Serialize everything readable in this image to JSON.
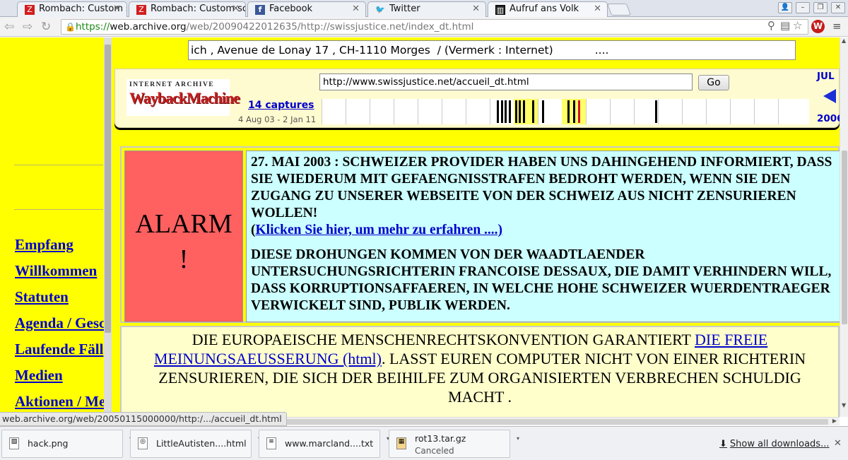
{
  "browser": {
    "tabs": [
      {
        "title": "Rombach: Custom sc",
        "icon": "zotero-icon"
      },
      {
        "title": "Rombach: Custom sc",
        "icon": "zotero-icon"
      },
      {
        "title": "Facebook",
        "icon": "facebook-icon"
      },
      {
        "title": "Twitter",
        "icon": "twitter-icon"
      },
      {
        "title": "Aufruf ans Volk",
        "icon": "wayback-icon"
      }
    ],
    "url": {
      "scheme": "https://",
      "host": "web.archive.org",
      "path": "/web/20090422012635/http://swissjustice.net/index_dt.html"
    }
  },
  "page": {
    "address_line": "ich , Avenue de Lonay 17 , CH-1110 Morges  / (Vermerk : Internet)            ....",
    "sidebar_links": [
      "Empfang",
      "Willkommen",
      "Statuten",
      "Agenda / Gesc",
      "Laufende Fäll",
      "Medien",
      "Aktionen / Me"
    ],
    "wayback": {
      "logo_top": "INTERNET ARCHIVE",
      "logo_main": "WaybackMachine",
      "url_value": "http://www.swissjustice.net/accueil_dt.html",
      "go_label": "Go",
      "captures": "14 captures",
      "date_range": "4 Aug 03 - 2 Jan 11",
      "month": "JUL",
      "year": "2006"
    },
    "alarm": {
      "line1": "ALARM",
      "line2": "!"
    },
    "message": {
      "para1": "27. MAI 2003 : SCHWEIZER PROVIDER HABEN UNS DAHINGEHEND INFORMIERT, DASS SIE WIEDERUM MIT GEFAENGNISSTRAFEN BEDROHT WERDEN, WENN SIE DEN ZUGANG ZU UNSERER WEBSEITE VON DER SCHWEIZ AUS NICHT ZENSURIEREN WOLLEN!",
      "link_open": "(",
      "link_text": "Klicken Sie hier, um mehr zu erfahren ....)",
      "para2": "DIESE  DROHUNGEN KOMMEN VON DER WAADTLAENDER UNTERSUCHUNGSRICHTERIN FRANCOISE DESSAUX, DIE DAMIT VERHINDERN WILL, DASS KORRUPTIONSAFFAEREN, IN WELCHE HOHE SCHWEIZER WUERDENTRAEGER VERWICKELT SIND, PUBLIK WERDEN."
    },
    "rights": {
      "before": "DIE EUROPAEISCHE MENSCHENRECHTSKONVENTION GARANTIERT ",
      "link": "DIE FREIE MEINUNGSAEUSSERUNG (html)",
      "after": ". LASST EUREN COMPUTER NICHT VON EINER RICHTERIN ZENSURIEREN, DIE SICH DER BEIHILFE ZUM ORGANISIERTEN VERBRECHEN SCHULDIG MACHT ."
    }
  },
  "status_bar": "web.archive.org/web/20050115000000/http:/.../accueil_dt.html",
  "downloads": {
    "items": [
      {
        "name": "hack.png",
        "status": ""
      },
      {
        "name": "LittleAutisten....html",
        "status": ""
      },
      {
        "name": "www.marcland....txt",
        "status": ""
      },
      {
        "name": "rot13.tar.gz",
        "status": "Canceled"
      }
    ],
    "show_all": "Show all downloads..."
  }
}
